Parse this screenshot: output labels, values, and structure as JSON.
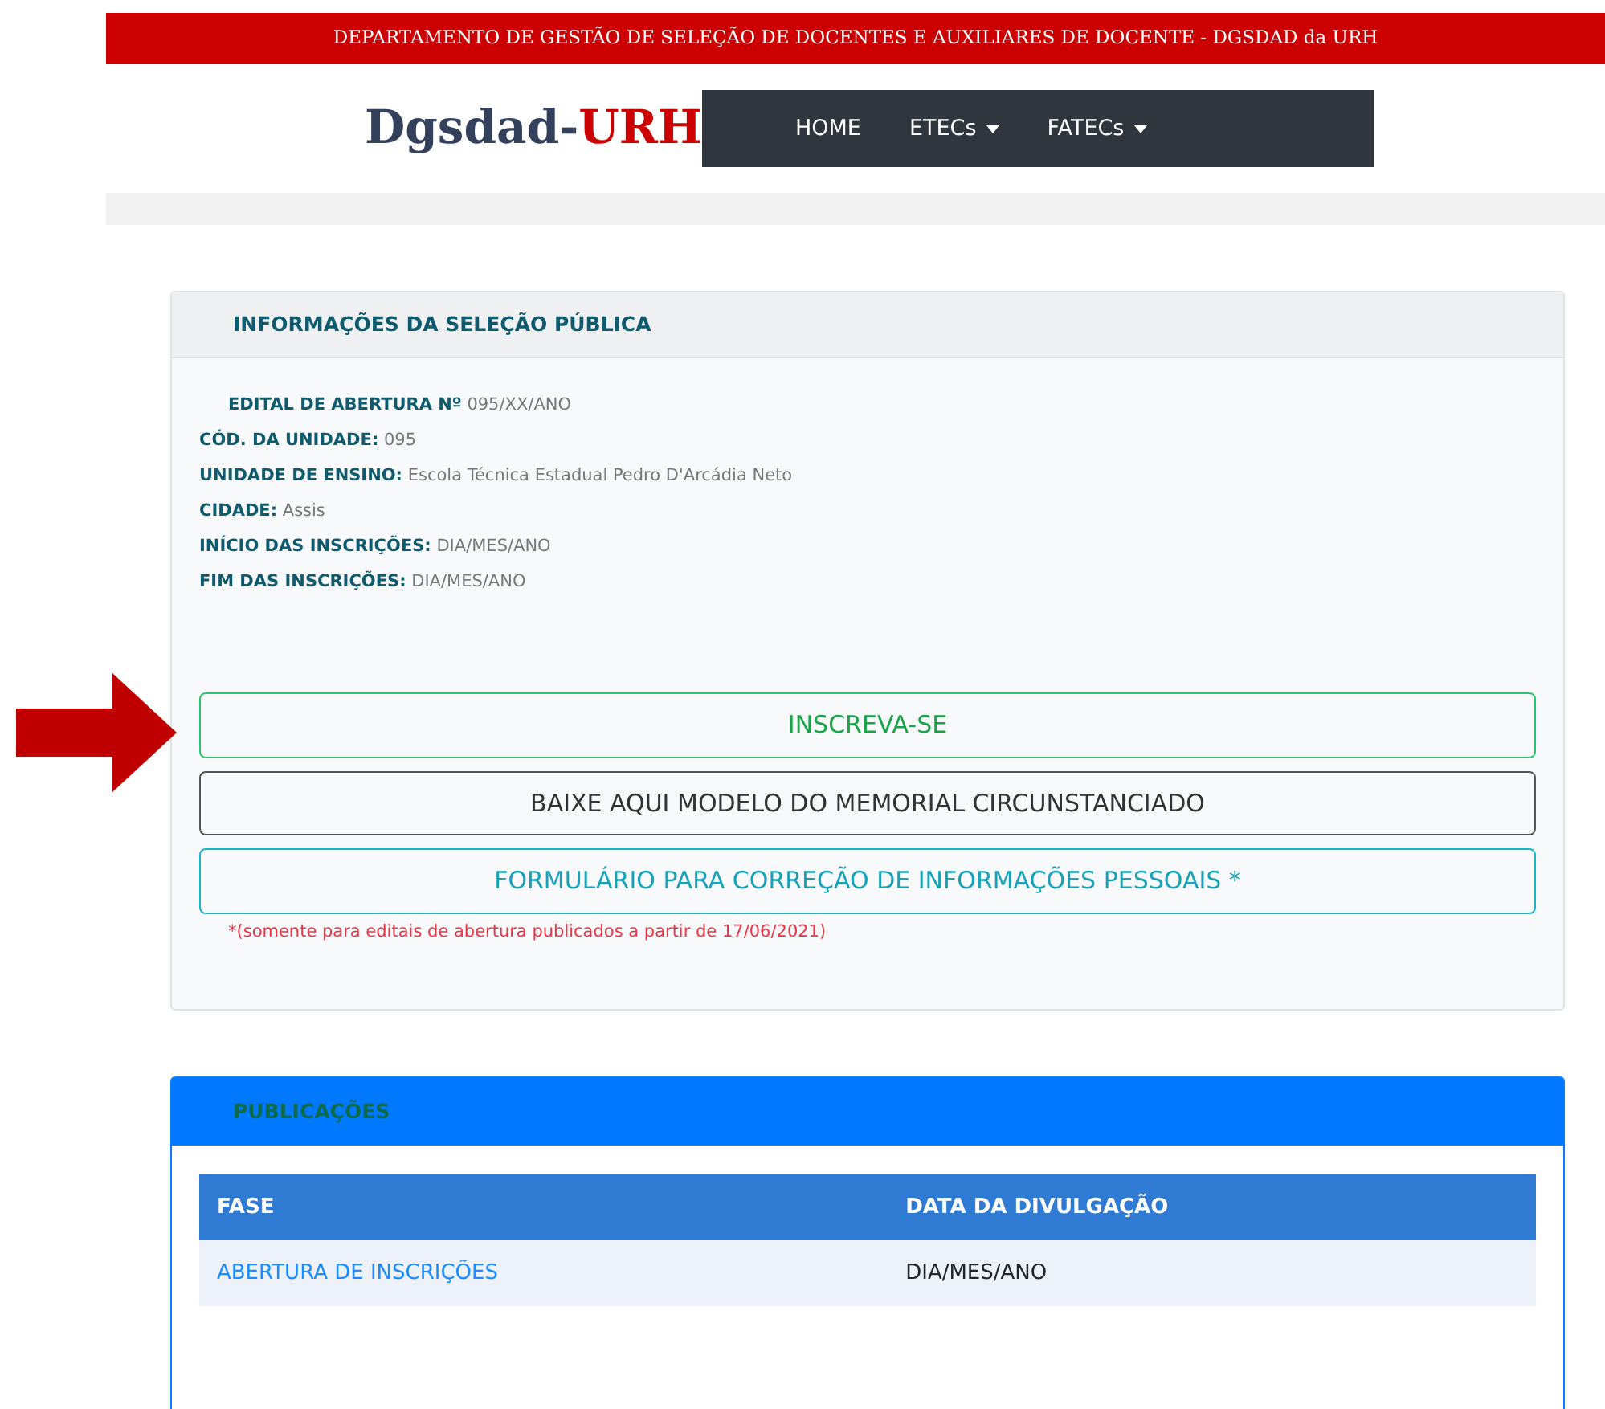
{
  "top_bar": {
    "text": "DEPARTAMENTO DE GESTÃO DE SELEÇÃO DE DOCENTES E AUXILIARES DE DOCENTE - DGSDAD da URH"
  },
  "logo": {
    "part_1": "Dgsdad-",
    "part_2": "URH"
  },
  "nav": [
    {
      "label": "HOME",
      "dropdown": false
    },
    {
      "label": "ETECs",
      "dropdown": true
    },
    {
      "label": "FATECs",
      "dropdown": true
    }
  ],
  "info_card": {
    "title": "INFORMAÇÕES DA SELEÇÃO PÚBLICA",
    "fields": [
      {
        "label": "EDITAL DE ABERTURA Nº",
        "value": "095/XX/ANO",
        "indented": true
      },
      {
        "label": "CÓD. DA UNIDADE:",
        "value": "095",
        "indented": false
      },
      {
        "label": "UNIDADE DE ENSINO:",
        "value": "Escola Técnica Estadual Pedro D'Arcádia Neto",
        "indented": false
      },
      {
        "label": "CIDADE:",
        "value": "Assis",
        "indented": false
      },
      {
        "label": "INÍCIO DAS INSCRIÇÕES:",
        "value": "DIA/MES/ANO",
        "indented": false
      },
      {
        "label": "FIM DAS INSCRIÇÕES:",
        "value": "DIA/MES/ANO",
        "indented": false
      }
    ],
    "buttons": [
      {
        "label": "INSCREVA-SE",
        "kind": "success",
        "pointed": true
      },
      {
        "label": "BAIXE AQUI MODELO DO MEMORIAL CIRCUNSTANCIADO",
        "kind": "dark",
        "pointed": false
      },
      {
        "label": "FORMULÁRIO PARA CORREÇÃO DE INFORMAÇÕES PESSOAIS *",
        "kind": "info",
        "pointed": false
      }
    ],
    "note": "*(somente para editais de abertura publicados a partir de 17/06/2021)"
  },
  "publications_card": {
    "title": "PUBLICAÇÕES",
    "table": {
      "columns": [
        "FASE",
        "DATA DA DIVULGAÇÃO"
      ],
      "rows": [
        [
          "ABERTURA DE INSCRIÇÕES",
          "DIA/MES/ANO"
        ]
      ]
    }
  }
}
